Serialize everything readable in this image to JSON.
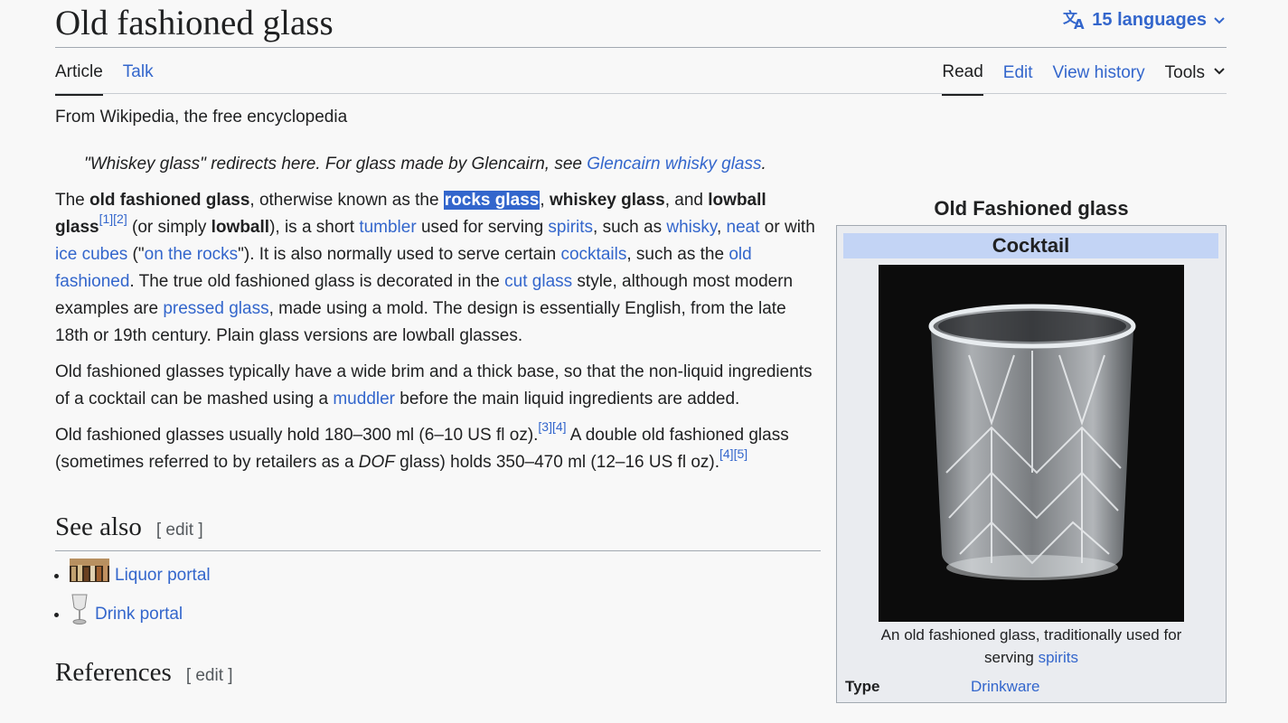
{
  "header": {
    "title": "Old fashioned glass",
    "languages": "15 languages"
  },
  "tabs": {
    "article": "Article",
    "talk": "Talk",
    "read": "Read",
    "edit": "Edit",
    "view_history": "View history",
    "tools": "Tools"
  },
  "tagline": "From Wikipedia, the free encyclopedia",
  "hatnote": {
    "text": "\"Whiskey glass\" redirects here. For glass made by Glencairn, see ",
    "link": "Glencairn whisky glass",
    "end": "."
  },
  "p1": {
    "t1": "The ",
    "b1": "old fashioned glass",
    "t2": ", otherwise known as the ",
    "sel": "rocks glass",
    "t3": ", ",
    "b2": "whiskey glass",
    "t4": ", and ",
    "b3": "lowball glass",
    "ref1": "[1]",
    "ref2": "[2]",
    "t5": " (or simply ",
    "b4": "lowball",
    "t6": "), is a short ",
    "l1": "tumbler",
    "t7": " used for serving ",
    "l2": "spirits",
    "t8": ", such as ",
    "l3": "whisky",
    "t9": ", ",
    "l4": "neat",
    "t10": " or with ",
    "l5": "ice cubes",
    "t11": " (\"",
    "l6": "on the rocks",
    "t12": "\"). It is also normally used to serve certain ",
    "l7": "cocktails",
    "t13": ", such as the ",
    "l8": "old fashioned",
    "t14": ". The true old fashioned glass is decorated in the ",
    "l9": "cut glass",
    "t15": " style, although most modern examples are ",
    "l10": "pressed glass",
    "t16": ", made using a mold. The design is essentially English, from the late 18th or 19th century. Plain glass versions are lowball glasses."
  },
  "p2": {
    "t1": "Old fashioned glasses typically have a wide brim and a thick base, so that the non-liquid ingredients of a cocktail can be mashed using a ",
    "l1": "muddler",
    "t2": " before the main liquid ingredients are added."
  },
  "p3": {
    "t1": "Old fashioned glasses usually hold 180–300 ml (6–10 US fl oz).",
    "ref3": "[3]",
    "ref4": "[4]",
    "t2": " A double old fashioned glass (sometimes referred to by retailers as a ",
    "i1": "DOF",
    "t3": " glass) holds 350–470 ml (12–16 US fl oz).",
    "ref4b": "[4]",
    "ref5": "[5]"
  },
  "see_also": {
    "heading": "See also",
    "edit": "[ edit ]",
    "items": [
      "Liquor portal",
      "Drink portal"
    ]
  },
  "references": {
    "heading": "References",
    "edit": "[ edit ]"
  },
  "infobox": {
    "title": "Old Fashioned glass",
    "header": "Cocktail",
    "caption": "An old fashioned glass, traditionally used for serving ",
    "caption_link": "spirits",
    "type_label": "Type",
    "type_value": "Drinkware"
  }
}
